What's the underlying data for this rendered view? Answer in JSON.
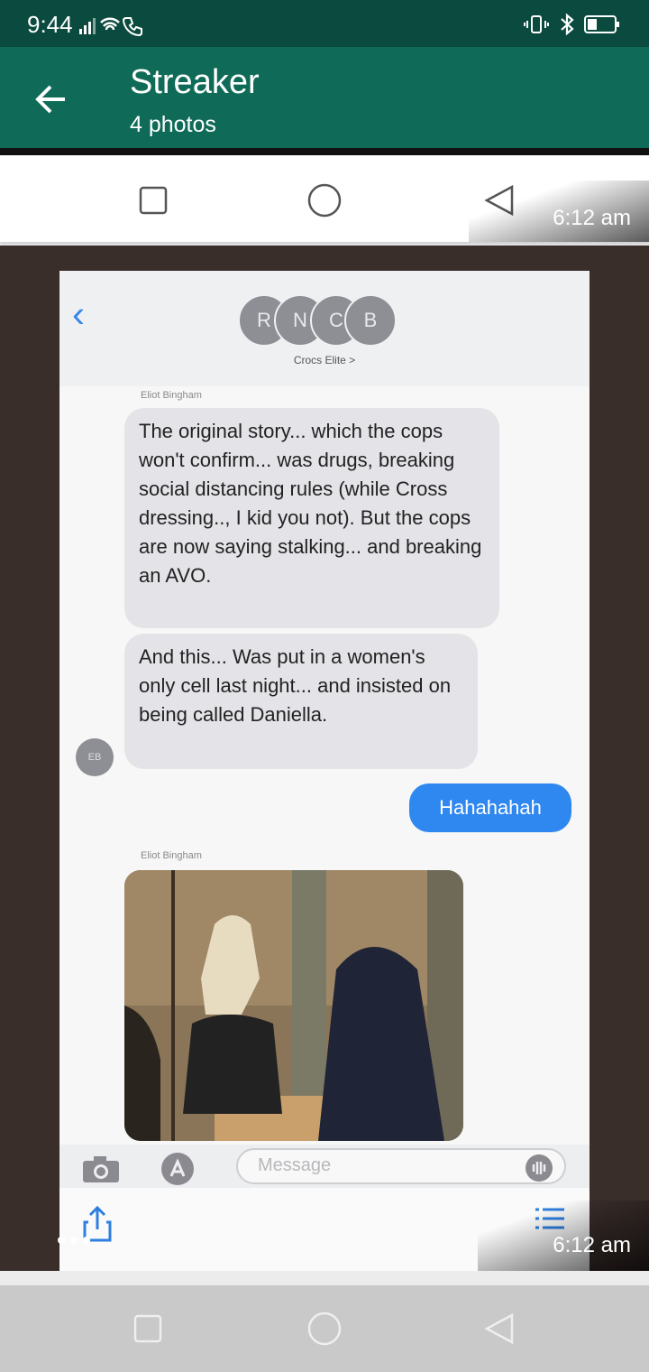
{
  "status_bar": {
    "time": "9:44"
  },
  "app_bar": {
    "title": "Streaker",
    "subtitle": "4 photos"
  },
  "photos": [
    {
      "timestamp": "6:12 am"
    },
    {
      "timestamp": "6:12 am"
    }
  ],
  "imessage": {
    "avatars": [
      "R",
      "N",
      "C",
      "B"
    ],
    "group_name": "Crocs Elite >",
    "sender_name": "Eliot Bingham",
    "messages": [
      "The original story... which the cops won't confirm... was drugs, breaking social distancing rules (while Cross dressing.., I kid you not). But the cops are now saying stalking... and breaking an AVO.",
      "And this... Was put in a women's only cell last night... and insisted on being called Daniella."
    ],
    "small_avatar": "EB",
    "reply": "Hahahahah",
    "input_placeholder": "Message"
  }
}
